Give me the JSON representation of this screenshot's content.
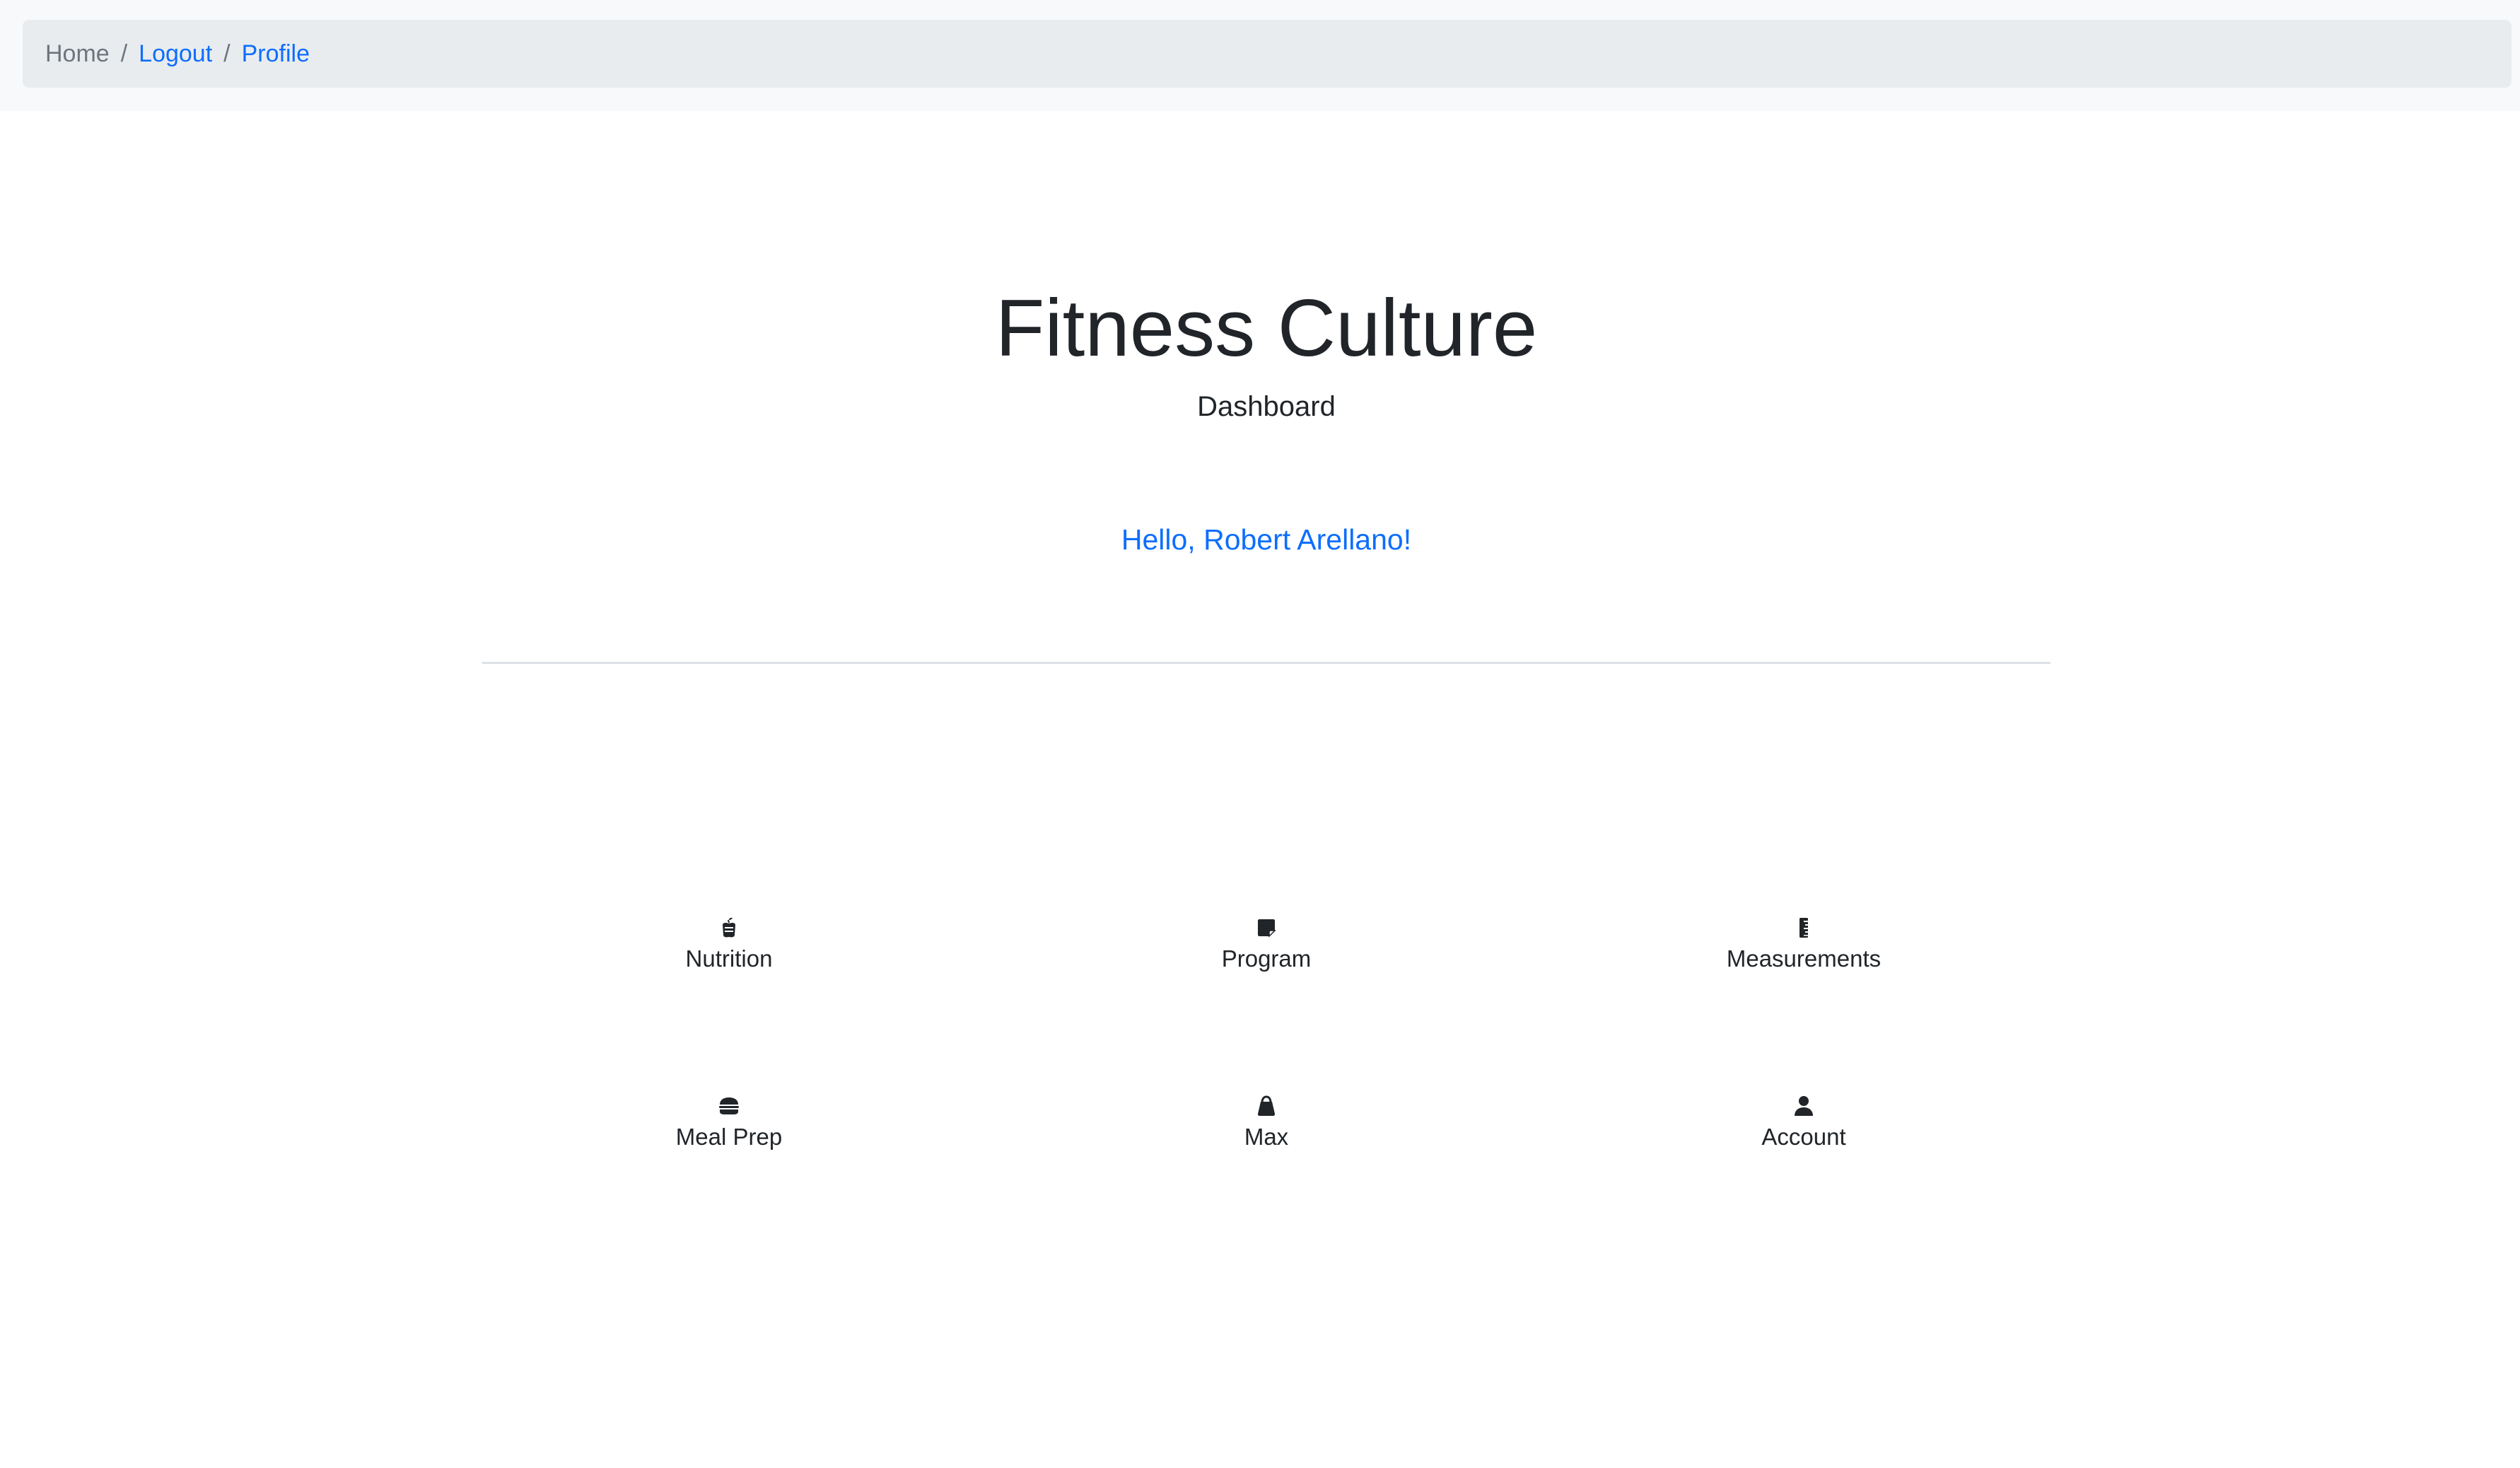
{
  "breadcrumb": {
    "items": [
      {
        "label": "Home",
        "type": "plain"
      },
      {
        "label": "Logout",
        "type": "link"
      },
      {
        "label": "Profile",
        "type": "link"
      }
    ],
    "separator": "/"
  },
  "header": {
    "title": "Fitness Culture",
    "subtitle": "Dashboard"
  },
  "greeting": "Hello, Robert Arellano!",
  "tiles": [
    {
      "label": "Nutrition",
      "icon": "apple-icon"
    },
    {
      "label": "Program",
      "icon": "sticky-note-icon"
    },
    {
      "label": "Measurements",
      "icon": "ruler-icon"
    },
    {
      "label": "Meal Prep",
      "icon": "burger-icon"
    },
    {
      "label": "Max",
      "icon": "kettlebell-icon"
    },
    {
      "label": "Account",
      "icon": "user-icon"
    }
  ],
  "colors": {
    "link": "#0d6efd",
    "text": "#212529",
    "muted": "#6c757d",
    "breadcrumb_bg": "#e9ecef",
    "navbar_bg": "#f8f9fa"
  }
}
